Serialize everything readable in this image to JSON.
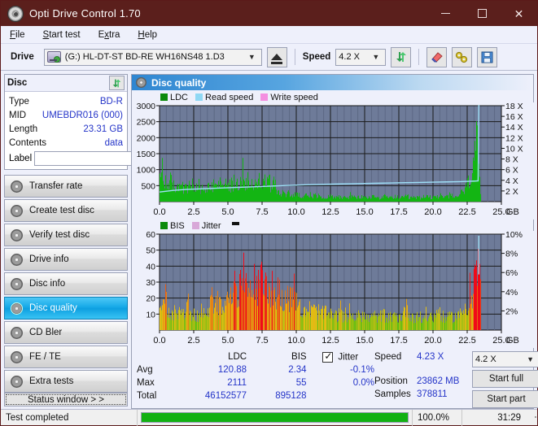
{
  "window": {
    "title": "Opti Drive Control 1.70",
    "app_icon": "disc-icon",
    "minimize": "–",
    "maximize": "□",
    "close": "✕"
  },
  "menu": {
    "items": [
      {
        "label": "File"
      },
      {
        "label": "Start test"
      },
      {
        "label": "Extra"
      },
      {
        "label": "Help"
      }
    ]
  },
  "toolbar": {
    "drive_label": "Drive",
    "drive_value": "(G:)  HL-DT-ST BD-RE  WH16NS48 1.D3",
    "eject_icon": "eject-icon",
    "speed_label": "Speed",
    "speed_value": "4.2 X",
    "refresh_icon": "refresh-icon",
    "erase_icon": "eraser-icon",
    "tools_icon": "wrench-icon",
    "save_icon": "floppy-save-icon"
  },
  "disc_panel": {
    "title": "Disc",
    "refresh_icon": "refresh-icon",
    "rows": [
      {
        "key": "Type",
        "value": "BD-R"
      },
      {
        "key": "MID",
        "value": "UMEBDR016 (000)"
      },
      {
        "key": "Length",
        "value": "23.31 GB"
      },
      {
        "key": "Contents",
        "value": "data"
      }
    ],
    "label_key": "Label",
    "label_value": "",
    "label_placeholder": "",
    "disc_icon": "cd-icon"
  },
  "nav": {
    "items": [
      {
        "label": "Transfer rate",
        "icon": "disc-icon",
        "active": false
      },
      {
        "label": "Create test disc",
        "icon": "disc-icon",
        "active": false
      },
      {
        "label": "Verify test disc",
        "icon": "disc-icon",
        "active": false
      },
      {
        "label": "Drive info",
        "icon": "disc-icon",
        "active": false
      },
      {
        "label": "Disc info",
        "icon": "disc-icon",
        "active": false
      },
      {
        "label": "Disc quality",
        "icon": "disc-icon",
        "active": true
      },
      {
        "label": "CD Bler",
        "icon": "disc-icon",
        "active": false
      },
      {
        "label": "FE / TE",
        "icon": "disc-icon",
        "active": false
      },
      {
        "label": "Extra tests",
        "icon": "disc-icon",
        "active": false
      }
    ],
    "status_window": "Status window > >"
  },
  "content": {
    "header": "Disc quality",
    "header_icon": "disc-icon"
  },
  "stats": {
    "columns": [
      "LDC",
      "BIS"
    ],
    "jitter_label": "Jitter",
    "jitter_checked": true,
    "rows": [
      {
        "label": "Avg",
        "ldc": "120.88",
        "bis": "2.34",
        "jitter": "-0.1%"
      },
      {
        "label": "Max",
        "ldc": "2111",
        "bis": "55",
        "jitter": "0.0%"
      },
      {
        "label": "Total",
        "ldc": "46152577",
        "bis": "895128",
        "jitter": ""
      }
    ],
    "speed_label": "Speed",
    "speed_value": "4.23 X",
    "position_label": "Position",
    "position_value": "23862 MB",
    "samples_label": "Samples",
    "samples_value": "378811",
    "speed_select": "4.2 X",
    "start_full": "Start full",
    "start_part": "Start part"
  },
  "statusbar": {
    "message": "Test completed",
    "percent_label": "100.0%",
    "percent": 100,
    "elapsed": "31:29"
  },
  "colors": {
    "ldc_green": "#13b513",
    "read_speed": "#8fd8f4",
    "write_speed": "#f48fe0",
    "bis_green": "#13b513",
    "jitter_pink": "#d8a8d8",
    "plot_bg": "#6e7b99",
    "accent": "#2434c8"
  },
  "chart_data": [
    {
      "type": "area",
      "name": "ldc-chart",
      "title": "",
      "xlabel": "GB",
      "ylabel": "",
      "xlim": [
        0.0,
        25.0
      ],
      "ylim": [
        0,
        3000
      ],
      "y2lim": [
        0,
        18
      ],
      "y2label": "X",
      "grid": true,
      "legend": [
        {
          "label": "LDC",
          "color": "#13b513"
        },
        {
          "label": "Read speed",
          "color": "#8fd8f4"
        },
        {
          "label": "Write speed",
          "color": "#f48fe0"
        }
      ],
      "xticks": [
        "0.0",
        "2.5",
        "5.0",
        "7.5",
        "10.0",
        "12.5",
        "15.0",
        "17.5",
        "20.0",
        "22.5",
        "25.0"
      ],
      "yticks": [
        3000,
        2500,
        2000,
        1500,
        1000,
        500
      ],
      "y2ticks": [
        "18 X",
        "16 X",
        "14 X",
        "12 X",
        "10 X",
        "8 X",
        "6 X",
        "4 X",
        "2 X"
      ],
      "series": [
        {
          "name": "LDC",
          "color": "#13b513",
          "x": [
            0.0,
            0.15,
            0.3,
            0.45,
            0.6,
            0.75,
            0.9,
            1.05,
            1.2,
            1.35,
            1.5,
            1.65,
            1.8,
            1.95,
            2.1,
            2.25,
            2.4,
            2.55,
            2.7,
            2.85,
            3.0,
            3.2,
            3.4,
            3.6,
            3.8,
            4.0,
            4.2,
            4.4,
            4.6,
            4.8,
            5.0,
            5.2,
            5.4,
            5.6,
            5.8,
            6.0,
            6.2,
            6.4,
            6.6,
            6.8,
            7.0,
            7.2,
            7.4,
            7.6,
            7.8,
            8.0,
            8.2,
            8.4,
            8.6,
            8.8,
            9.0,
            9.3,
            9.6,
            9.9,
            10.2,
            10.5,
            10.8,
            11.1,
            11.4,
            11.7,
            12.0,
            12.4,
            12.8,
            13.2,
            13.6,
            14.0,
            14.4,
            14.8,
            15.2,
            15.6,
            16.0,
            16.4,
            16.8,
            17.2,
            17.6,
            18.0,
            18.4,
            18.8,
            19.2,
            19.6,
            20.0,
            20.4,
            20.8,
            21.2,
            21.6,
            22.0,
            22.3,
            22.6,
            22.9,
            23.1,
            23.25,
            23.35,
            23.45,
            23.5
          ],
          "values": [
            700,
            1020,
            620,
            900,
            560,
            830,
            520,
            640,
            480,
            600,
            420,
            540,
            400,
            520,
            430,
            700,
            450,
            520,
            430,
            600,
            400,
            470,
            420,
            560,
            430,
            600,
            450,
            640,
            470,
            690,
            500,
            640,
            520,
            700,
            560,
            940,
            600,
            880,
            560,
            800,
            540,
            880,
            580,
            780,
            540,
            760,
            500,
            660,
            300,
            320,
            280,
            300,
            240,
            270,
            210,
            250,
            190,
            230,
            170,
            210,
            160,
            200,
            150,
            190,
            140,
            180,
            135,
            175,
            130,
            190,
            128,
            185,
            126,
            180,
            124,
            175,
            122,
            170,
            120,
            200,
            130,
            190,
            135,
            210,
            150,
            280,
            420,
            700,
            1400,
            2111,
            1800,
            900,
            200,
            60
          ]
        },
        {
          "name": "Read speed",
          "color": "#8fd8f4",
          "x": [
            0.0,
            1.0,
            2.0,
            3.0,
            4.0,
            5.0,
            6.0,
            7.0,
            8.0,
            9.0,
            10.0,
            11.0,
            12.0,
            13.0,
            14.0,
            15.0,
            16.0,
            17.0,
            18.0,
            19.0,
            20.0,
            21.0,
            22.0,
            22.5,
            23.0,
            23.3,
            23.35,
            23.4
          ],
          "values": [
            1.8,
            2.1,
            2.3,
            2.4,
            2.5,
            2.6,
            2.7,
            2.8,
            2.9,
            3.0,
            3.1,
            3.2,
            3.25,
            3.3,
            3.35,
            3.4,
            3.45,
            3.5,
            3.55,
            3.6,
            3.65,
            3.7,
            3.75,
            3.8,
            3.85,
            3.9,
            18.0,
            18.0
          ]
        }
      ]
    },
    {
      "type": "area",
      "name": "bis-chart",
      "title": "",
      "xlabel": "GB",
      "ylabel": "",
      "xlim": [
        0.0,
        25.0
      ],
      "ylim": [
        0,
        60
      ],
      "y2lim": [
        0,
        10
      ],
      "y2label": "%",
      "grid": true,
      "legend": [
        {
          "label": "BIS",
          "color": "#13b513"
        },
        {
          "label": "Jitter",
          "color": "#d8a8d8"
        }
      ],
      "xticks": [
        "0.0",
        "2.5",
        "5.0",
        "7.5",
        "10.0",
        "12.5",
        "15.0",
        "17.5",
        "20.0",
        "22.5",
        "25.0"
      ],
      "yticks": [
        60,
        50,
        40,
        30,
        20,
        10
      ],
      "y2ticks": [
        "10%",
        "8%",
        "6%",
        "4%",
        "2%"
      ],
      "series": [
        {
          "name": "BIS",
          "color": "gradient-green-red",
          "x": [
            0.0,
            0.2,
            0.4,
            0.5,
            0.6,
            0.8,
            1.0,
            1.2,
            1.4,
            1.6,
            1.8,
            2.0,
            2.2,
            2.4,
            2.6,
            2.8,
            3.0,
            3.2,
            3.4,
            3.6,
            3.8,
            4.0,
            4.2,
            4.4,
            4.6,
            4.8,
            5.0,
            5.2,
            5.4,
            5.6,
            5.8,
            6.0,
            6.2,
            6.4,
            6.6,
            6.8,
            7.0,
            7.2,
            7.4,
            7.5,
            7.6,
            7.8,
            8.0,
            8.2,
            8.4,
            8.6,
            8.8,
            9.0,
            9.2,
            9.4,
            9.6,
            9.8,
            10.0,
            10.4,
            10.8,
            11.2,
            11.6,
            12.0,
            12.4,
            12.8,
            13.2,
            13.6,
            14.0,
            14.4,
            14.8,
            15.2,
            15.6,
            16.0,
            16.4,
            16.8,
            17.2,
            17.6,
            18.0,
            18.4,
            18.8,
            19.2,
            19.6,
            20.0,
            20.4,
            20.8,
            21.2,
            21.6,
            22.0,
            22.3,
            22.6,
            22.9,
            23.1,
            23.25,
            23.35,
            23.45,
            23.5
          ],
          "values": [
            14,
            12,
            27,
            16,
            12,
            11,
            13,
            10,
            12,
            11,
            14,
            16,
            10,
            9,
            11,
            10,
            12,
            13,
            16,
            15,
            18,
            17,
            20,
            19,
            21,
            20,
            23,
            22,
            32,
            26,
            30,
            28,
            33,
            27,
            31,
            29,
            37,
            30,
            34,
            36,
            31,
            33,
            29,
            31,
            27,
            28,
            25,
            26,
            22,
            24,
            20,
            21,
            18,
            16,
            15,
            14,
            13,
            12,
            11,
            10,
            11,
            9,
            10,
            9,
            11,
            8,
            10,
            9,
            11,
            8,
            10,
            9,
            16,
            10,
            9,
            8,
            10,
            9,
            14,
            8,
            9,
            10,
            11,
            16,
            20,
            30,
            42,
            50,
            48,
            30,
            10
          ]
        },
        {
          "name": "Jitter",
          "color": "#8fd8f4",
          "x": [
            23.3,
            23.35,
            23.4
          ],
          "values": [
            10.0,
            10.0,
            10.0
          ]
        }
      ]
    }
  ]
}
